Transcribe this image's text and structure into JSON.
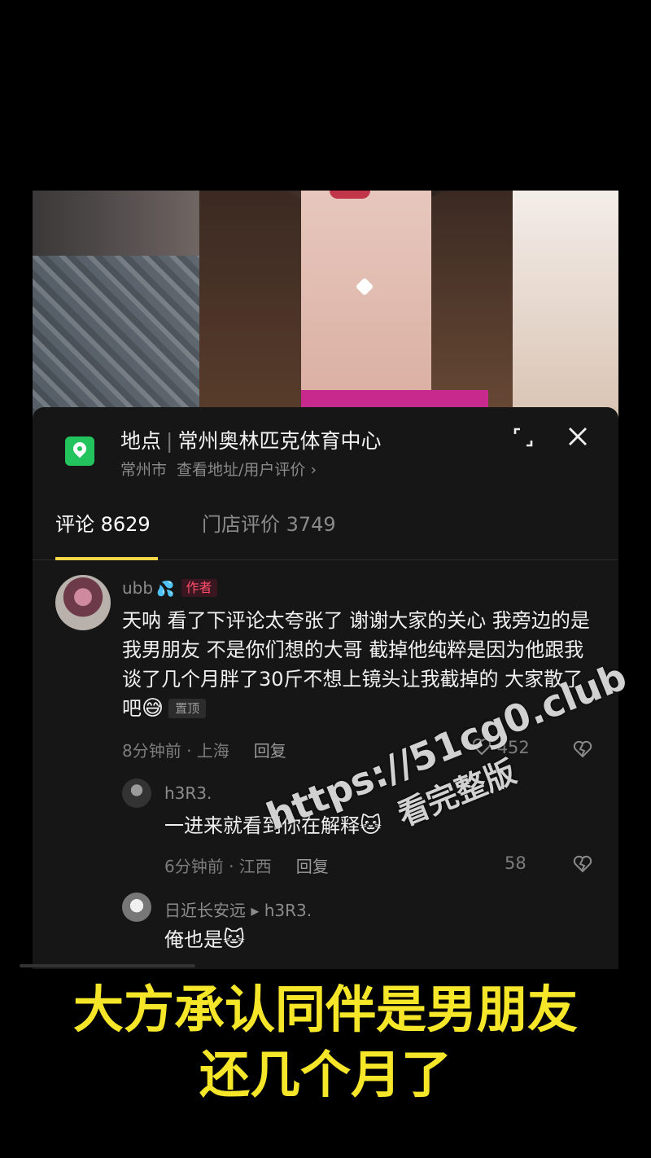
{
  "location": {
    "label": "地点",
    "name": "常州奥林匹克体育中心",
    "city": "常州市",
    "link": "查看地址/用户评价 ›"
  },
  "tabs": [
    {
      "label": "评论 8629"
    },
    {
      "label": "门店评价 3749"
    }
  ],
  "comments": [
    {
      "username": "ubb",
      "badge": "作者",
      "text": "天呐 看了下评论太夸张了 谢谢大家的关心 我旁边的是我男朋友 不是你们想的大哥 截掉他纯粹是因为他跟我谈了几个月胖了30斤不想上镜头让我截掉的 大家散了吧",
      "emoji": "😅",
      "pin": "置顶",
      "time": "8分钟前 · 上海",
      "reply": "回复",
      "likes": "452"
    },
    {
      "username": "h3R3.",
      "text": "一进来就看到你在解释",
      "emoji": "🐱",
      "time": "6分钟前 · 江西",
      "reply": "回复",
      "likes": "58"
    },
    {
      "username": "日近长安远",
      "reply_to": "▸ h3R3.",
      "text": "俺也是",
      "emoji": "🐱"
    }
  ],
  "watermark": {
    "line1": "https://51cg0.club",
    "line2": "看完整版"
  },
  "caption": {
    "line1": "大方承认同伴是男朋友",
    "line2": "还几个月了"
  },
  "colors": {
    "caption": "#f5e62a",
    "tab_underline": "#f7d748",
    "location_icon": "#23c45e",
    "author_badge": "#ff4d6a"
  }
}
